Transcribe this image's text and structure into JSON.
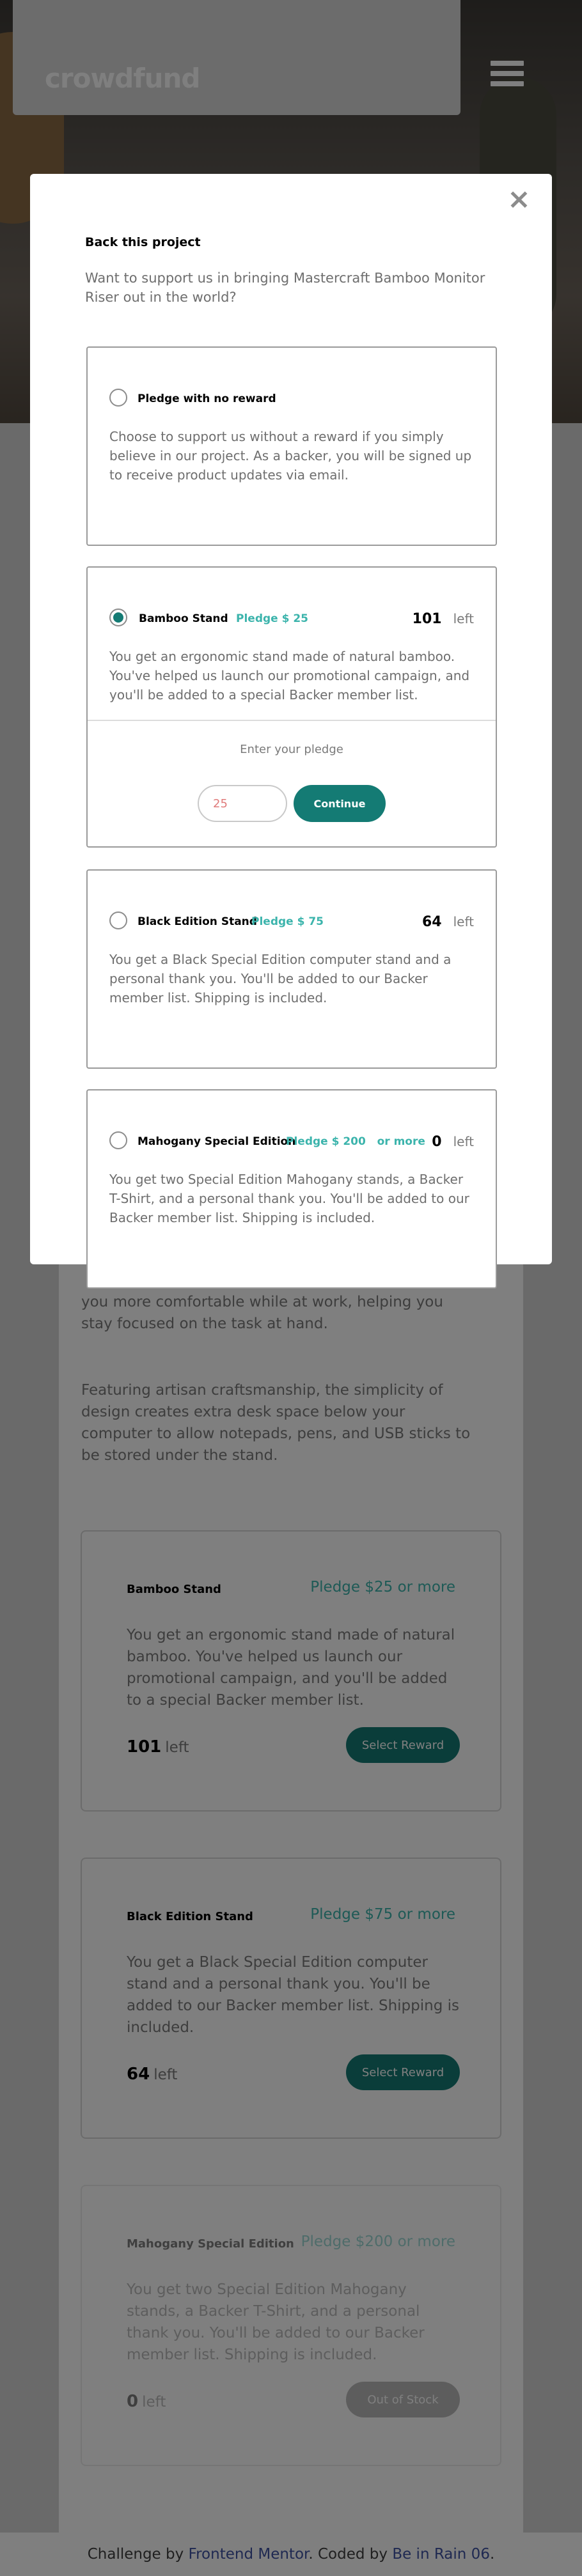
{
  "brand": {
    "logo": "crowdfund"
  },
  "about": {
    "p2": "you more comfortable while at work, helping you stay focused on the task at hand.",
    "p3": "Featuring artisan craftsmanship, the simplicity of design creates extra desk space below your computer to allow notepads, pens, and USB sticks to be stored under the stand."
  },
  "rewards": [
    {
      "name": "Bamboo Stand",
      "min": "Pledge $25 or more",
      "desc": "You get an ergonomic stand made of natural bamboo. You've helped us launch our promotional campaign, and you'll be added to a special Backer member list.",
      "left_num": "101",
      "left_label": "left",
      "button": "Select Reward"
    },
    {
      "name": "Black Edition Stand",
      "min": "Pledge $75 or more",
      "desc": "You get a Black Special Edition computer stand and a personal thank you. You'll be added to our Backer member list. Shipping is included.",
      "left_num": "64",
      "left_label": "left",
      "button": "Select Reward"
    },
    {
      "name": "Mahogany Special Edition",
      "min": "Pledge $200 or more",
      "desc": "You get two Special Edition Mahogany stands, a Backer T-Shirt, and a personal thank you. You'll be added to our Backer member list. Shipping is included.",
      "left_num": "0",
      "left_label": "left",
      "button": "Out of Stock"
    }
  ],
  "footer": {
    "prefix": "Challenge by ",
    "fm": "Frontend Mentor",
    "mid": ". Coded by ",
    "author": "Be in Rain 06",
    "suffix": "."
  },
  "modal": {
    "close": "×",
    "title": "Back this project",
    "intro": "Want to support us in bringing Mastercraft Bamboo Monitor Riser out in the world?",
    "options": [
      {
        "name": "Pledge with no reward",
        "pledge": "",
        "left_num": "",
        "left_label": "",
        "desc": "Choose to support us without a reward if you simply believe in our project. As a backer, you will be signed up to receive product updates via email.",
        "selected": false
      },
      {
        "name": "Bamboo Stand",
        "pledge": "Pledge $ 25",
        "left_num": "101",
        "left_label": "left",
        "desc": "You get an ergonomic stand made of natural bamboo. You've helped us launch our promotional campaign, and you'll be added to a special Backer member list.",
        "selected": true
      },
      {
        "name": "Black Edition Stand",
        "pledge": "Pledge $ 75",
        "left_num": "64",
        "left_label": "left",
        "desc": "You get a Black Special Edition computer stand and a personal thank you. You'll be added to our Backer member list. Shipping is included.",
        "selected": false
      },
      {
        "name": "Mahogany Special Edition",
        "pledge": "Pledge $ 200   or more",
        "left_num": "0",
        "left_label": "left",
        "desc": "You get two Special Edition Mahogany stands, a Backer T-Shirt, and a personal thank you. You'll be added to our Backer member list. Shipping is included.",
        "selected": false
      }
    ],
    "pledge_entry": {
      "label": "Enter your pledge",
      "value": "25",
      "button": "Continue"
    }
  },
  "colors": {
    "primary": "#3cb4ac",
    "primary_dark": "#147b74",
    "overlay": "rgba(0,0,0,0.5)"
  }
}
